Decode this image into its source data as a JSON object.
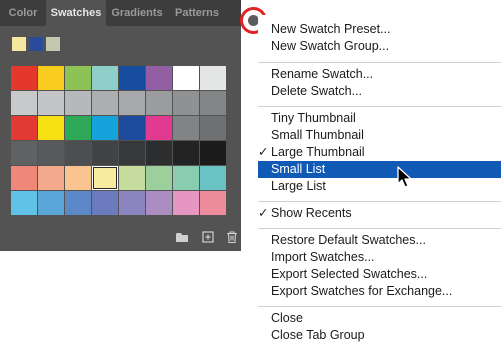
{
  "panel": {
    "tabs": [
      {
        "label": "Color"
      },
      {
        "label": "Swatches"
      },
      {
        "label": "Gradients"
      },
      {
        "label": "Patterns"
      }
    ],
    "active_tab": "Swatches",
    "recent_swatches": [
      "#f5e6a0",
      "#2a4c9b",
      "#c3c8b1"
    ],
    "swatch_rows": [
      [
        "#e4382d",
        "#f8cd1d",
        "#8dc356",
        "#8fcfc9",
        "#174d9f",
        "#935fa4",
        "#ffffff",
        "#e4e6e6"
      ],
      [
        "#c7c9cb",
        "#c3c5c7",
        "#b6b8ba",
        "#adaeb0",
        "#a7a9ab",
        "#9b9c9e",
        "#8f9192",
        "#848586"
      ],
      [
        "#e03a32",
        "#f7e014",
        "#2ea957",
        "#15a3dc",
        "#1f4b9e",
        "#e23991",
        "#828384",
        "#6f7072"
      ],
      [
        "#606163",
        "#58595b",
        "#4d4e50",
        "#424345",
        "#373839",
        "#2c2d2e",
        "#232324",
        "#1c1c1c"
      ],
      [
        "#ef8878",
        "#f3a98c",
        "#f9c490",
        "#f8ec9e",
        "#c6dc9e",
        "#9ccf9c",
        "#89cdb0",
        "#69c3c5"
      ],
      [
        "#5fc2e6",
        "#5ba6d9",
        "#5d88c8",
        "#6c7bbd",
        "#8c84be",
        "#ac8dc1",
        "#e597c2",
        "#ec8c9c"
      ]
    ],
    "selected_swatch": "row 5, column 4",
    "footer_icons": [
      "folder-icon",
      "new-swatch-icon",
      "trash-icon"
    ]
  },
  "menu": {
    "items": [
      {
        "label": "New Swatch Preset...",
        "checked": false,
        "highlighted": false
      },
      {
        "label": "New Swatch Group...",
        "checked": false,
        "highlighted": false
      },
      {
        "label": "Rename Swatch...",
        "checked": false,
        "highlighted": false
      },
      {
        "label": "Delete Swatch...",
        "checked": false,
        "highlighted": false
      },
      {
        "label": "Tiny Thumbnail",
        "checked": false,
        "highlighted": false
      },
      {
        "label": "Small Thumbnail",
        "checked": false,
        "highlighted": false
      },
      {
        "label": "Large Thumbnail",
        "checked": true,
        "highlighted": false
      },
      {
        "label": "Small List",
        "checked": false,
        "highlighted": true
      },
      {
        "label": "Large List",
        "checked": false,
        "highlighted": false
      },
      {
        "label": "Show Recents",
        "checked": true,
        "highlighted": false
      },
      {
        "label": "Restore Default Swatches...",
        "checked": false,
        "highlighted": false
      },
      {
        "label": "Import Swatches...",
        "checked": false,
        "highlighted": false
      },
      {
        "label": "Export Selected Swatches...",
        "checked": false,
        "highlighted": false
      },
      {
        "label": "Export Swatches for Exchange...",
        "checked": false,
        "highlighted": false
      },
      {
        "label": "Close",
        "checked": false,
        "highlighted": false
      },
      {
        "label": "Close Tab Group",
        "checked": false,
        "highlighted": false
      }
    ],
    "check_glyph": "✓"
  },
  "colors": {
    "highlight": "#1059b4",
    "annotation_circle": "#e02424",
    "panel_bg": "#535353",
    "tabbar_bg": "#3d3d3d"
  }
}
